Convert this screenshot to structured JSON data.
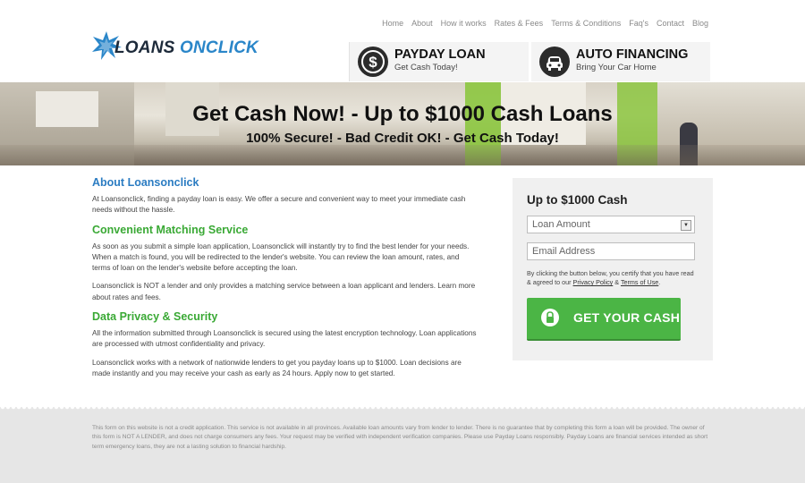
{
  "brand": {
    "logo_part1": "LOANS ",
    "logo_part2": "ONCLICK"
  },
  "nav": [
    "Home",
    "About",
    "How it works",
    "Rates & Fees",
    "Terms & Conditions",
    "Faq's",
    "Contact",
    "Blog"
  ],
  "promos": [
    {
      "title": "PAYDAY LOAN",
      "subtitle": "Get Cash Today!",
      "icon": "dollar-icon"
    },
    {
      "title": "AUTO FINANCING",
      "subtitle": "Bring Your Car Home",
      "icon": "car-icon"
    }
  ],
  "hero": {
    "title": "Get Cash Now! - Up to $1000 Cash Loans",
    "subtitle": "100% Secure! - Bad Credit OK! - Get Cash Today!"
  },
  "content": {
    "about_heading": "About Loansonclick",
    "about_text": "At Loansonclick, finding a payday loan is easy. We offer a secure and convenient way to meet your immediate cash needs without the hassle.",
    "matching_heading": "Convenient Matching Service",
    "matching_text1": "As soon as you submit a simple loan application, Loansonclick will instantly try to find the best lender for your needs. When a match is found, you will be redirected to the lender's website. You can review the loan amount, rates, and terms of loan on the lender's website before accepting the loan.",
    "matching_text2": "Loansonclick is NOT a lender and only provides a matching service between a loan applicant and lenders. Learn more about rates and fees.",
    "privacy_heading": "Data Privacy & Security",
    "privacy_text1": "All the information submitted through Loansonclick is secured using the latest encryption technology. Loan applications are processed with utmost confidentiality and privacy.",
    "privacy_text2": "Loansonclick works with a network of nationwide lenders to get you payday loans up to $1000. Loan decisions are made instantly and you may receive your cash as early as 24 hours. Apply now to get started."
  },
  "form": {
    "title": "Up to $1000 Cash",
    "loan_amount_placeholder": "Loan Amount",
    "email_placeholder": "Email Address",
    "disclaimer_prefix": "By clicking the button below, you certify that you have read & agreed to our ",
    "privacy_link": "Privacy Policy",
    "and": " & ",
    "terms_link": "Terms of Use",
    "period": ".",
    "cta_label": "GET YOUR CASH"
  },
  "footer": {
    "text": "This form on this website is not a credit application. This service is not available in all provinces. Available loan amounts vary from lender to lender. There is no guarantee that by completing this form a loan will be provided. The owner of this form is NOT A LENDER, and does not charge consumers any fees. Your request may be verified with independent verification companies. Please use Payday Loans responsibly. Payday Loans are financial services intended as short term emergency loans, they are not a lasting solution to financial hardship."
  },
  "colors": {
    "accent_blue": "#2b7cc2",
    "accent_green": "#3aa935",
    "cta_green": "#4bb545"
  }
}
